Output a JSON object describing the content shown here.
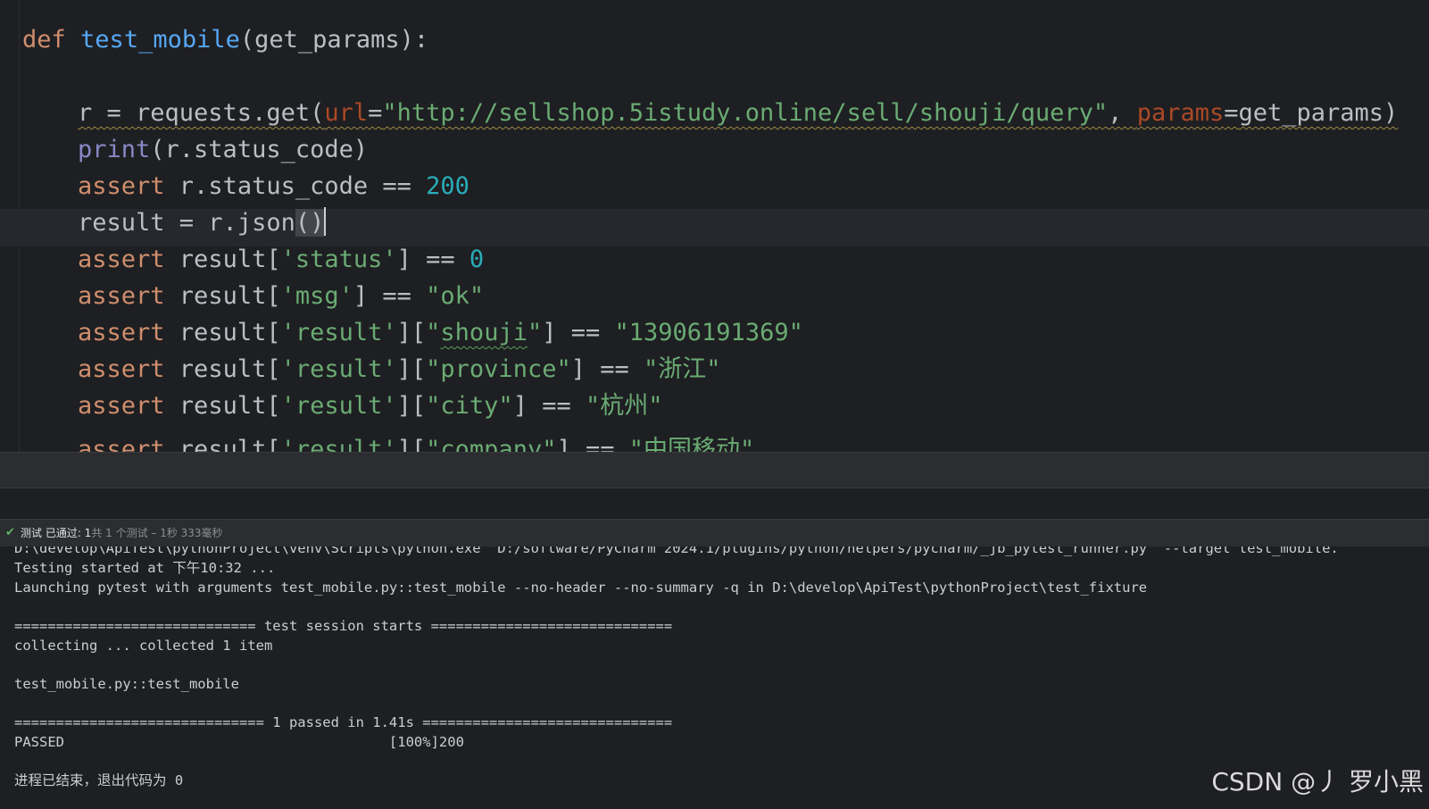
{
  "editor": {
    "line1": {
      "kw": "def",
      "fn": "test_mobile",
      "rest": "(get_params):"
    },
    "line3": {
      "lhs": "r = requests.get(",
      "url_param": "url",
      "eq1": "=",
      "url_value": "\"http://sellshop.5istudy.online/sell/shouji/query\"",
      "sep": ", ",
      "params_param": "params",
      "eq2": "=",
      "params_value": "get_params)"
    },
    "line4": {
      "builtin": "print",
      "rest": "(r.status_code)"
    },
    "line5": {
      "kw": "assert",
      "rest": " r.status_code == ",
      "num": "200"
    },
    "line6": {
      "text": "result = r.json",
      "paren": "()"
    },
    "line7": {
      "kw": "assert",
      "pre": " result[",
      "str": "'status'",
      "post": "] == ",
      "num": "0"
    },
    "line8": {
      "kw": "assert",
      "pre": " result[",
      "str": "'msg'",
      "post": "] == ",
      "val": "\"ok\""
    },
    "line9": {
      "kw": "assert",
      "pre": " result[",
      "str1": "'result'",
      "mid": "][",
      "q1": "\"",
      "key": "shouji",
      "q2": "\"",
      "post": "] == ",
      "val": "\"13906191369\""
    },
    "line10": {
      "kw": "assert",
      "pre": " result[",
      "str1": "'result'",
      "mid": "][",
      "str2": "\"province\"",
      "post": "] == ",
      "val": "\"浙江\""
    },
    "line11": {
      "kw": "assert",
      "pre": " result[",
      "str1": "'result'",
      "mid": "][",
      "str2": "\"city\"",
      "post": "] == ",
      "val": "\"杭州\""
    },
    "line12": {
      "kw": "assert",
      "pre": " result[",
      "str1": "'result'",
      "mid": "][",
      "str2": "\"company\"",
      "post": "] == ",
      "val": "\"中国移动\""
    }
  },
  "status": {
    "check_icon": "check-icon",
    "label": "测试 已通过: 1",
    "detail": "共 1 个测试 – 1秒 333毫秒"
  },
  "console": {
    "lines": [
      "D:\\develop\\ApiTest\\pythonProject\\venv\\Scripts\\python.exe \"D:/software/PyCharm 2024.1/plugins/python/helpers/pycharm/_jb_pytest_runner.py\" --target test_mobile.",
      "Testing started at 下午10:32 ...",
      "Launching pytest with arguments test_mobile.py::test_mobile --no-header --no-summary -q in D:\\develop\\ApiTest\\pythonProject\\test_fixture",
      "",
      "============================= test session starts =============================",
      "collecting ... collected 1 item",
      "",
      "test_mobile.py::test_mobile",
      "",
      "============================== 1 passed in 1.41s ==============================",
      "PASSED                                       [100%]200",
      "",
      "进程已结束，退出代码为 0"
    ]
  },
  "watermark": "CSDN @丿 罗小黑",
  "colors": {
    "background": "#1e1f22",
    "keyword": "#cf8e6d",
    "function": "#56a8f5",
    "string": "#6aab73",
    "number": "#2aacb8",
    "param": "#aa4926",
    "pass": "#5fb865"
  }
}
